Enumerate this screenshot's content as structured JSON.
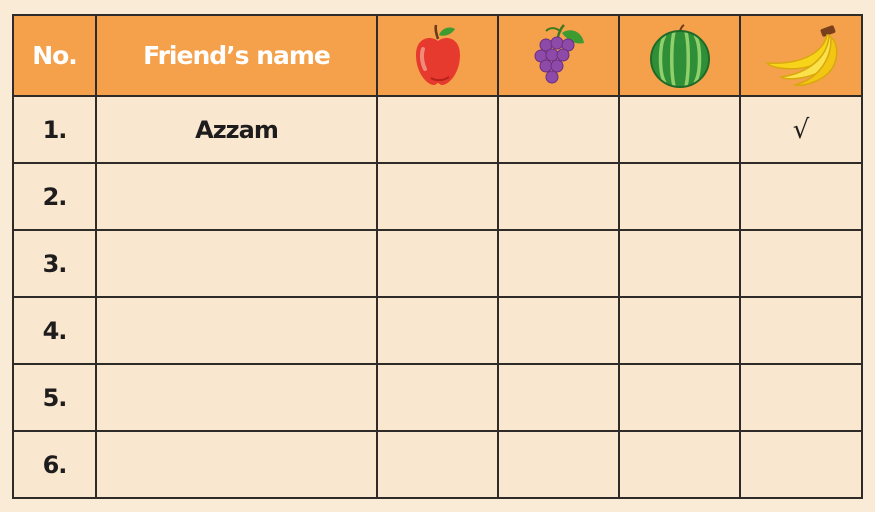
{
  "table": {
    "headers": {
      "no": "No.",
      "name": "Friend’s name",
      "fruits": [
        "apple-icon",
        "grapes-icon",
        "watermelon-icon",
        "banana-icon"
      ]
    },
    "rows": [
      {
        "no": "1.",
        "name": "Azzam",
        "marks": [
          "",
          "",
          "",
          "√"
        ]
      },
      {
        "no": "2.",
        "name": "",
        "marks": [
          "",
          "",
          "",
          ""
        ]
      },
      {
        "no": "3.",
        "name": "",
        "marks": [
          "",
          "",
          "",
          ""
        ]
      },
      {
        "no": "4.",
        "name": "",
        "marks": [
          "",
          "",
          "",
          ""
        ]
      },
      {
        "no": "5.",
        "name": "",
        "marks": [
          "",
          "",
          "",
          ""
        ]
      },
      {
        "no": "6.",
        "name": "",
        "marks": [
          "",
          "",
          "",
          ""
        ]
      }
    ]
  },
  "colors": {
    "header_bg": "#f5a14c",
    "cell_bg": "#f9e8cf",
    "page_bg": "#f9ebd5",
    "border": "#2f2b28"
  }
}
